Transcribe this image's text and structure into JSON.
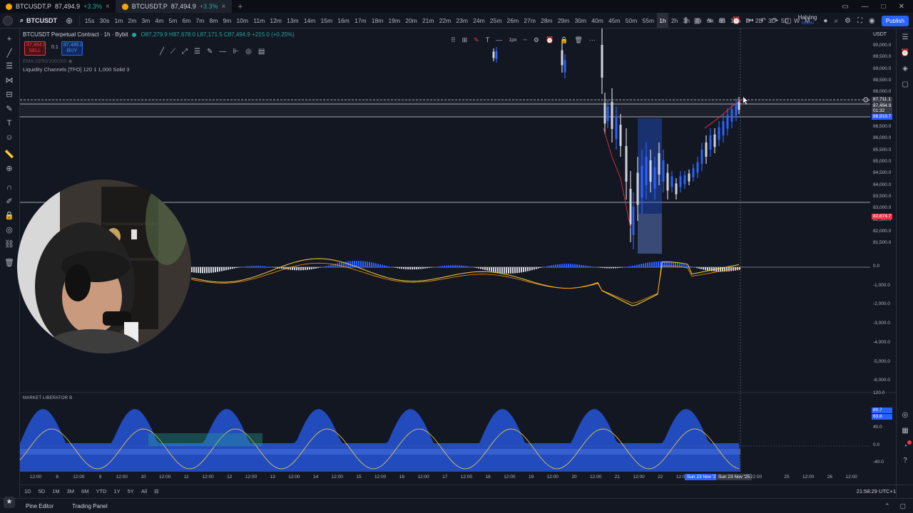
{
  "browser": {
    "tabs": [
      {
        "title": "BTCUSDT.P",
        "price": "87,494.9",
        "change": "+3.3%",
        "close": "×"
      },
      {
        "title": "BTCUSDT.P",
        "price": "87,494.9",
        "change": "+3.3%",
        "close": "×"
      }
    ],
    "add_tab": "+"
  },
  "toolbar": {
    "symbol": "BTCUSDT",
    "timeframes": [
      "15s",
      "30s",
      "1m",
      "2m",
      "3m",
      "4m",
      "5m",
      "6m",
      "7m",
      "8m",
      "9m",
      "10m",
      "11m",
      "12m",
      "13m",
      "14m",
      "15m",
      "16m",
      "17m",
      "18m",
      "19m",
      "20m",
      "21m",
      "22m",
      "23m",
      "24m",
      "25m",
      "26m",
      "27m",
      "28m",
      "29m",
      "30m",
      "40m",
      "45m",
      "50m",
      "55m",
      "1h",
      "2h",
      "3h",
      "4h",
      "6h",
      "8h",
      "12h",
      "D",
      "2D",
      "3D",
      "5D",
      "W",
      "M"
    ],
    "active_timeframe": "1h",
    "halving": "Halving",
    "halving_sub": "SOON",
    "publish": "Publish"
  },
  "legend": {
    "title": "BTCUSDT Perpetual Contract · 1h · Bybit",
    "ohlc": "O87,279.9 H87,678.0 L87,171.5 C87,494.9 +215.0 (+0.25%)",
    "sell_price": "87,494.9",
    "sell_label": "SELL",
    "spread": "0.1",
    "buy_price": "87,495.0",
    "buy_label": "BUY",
    "ema": "EMA 20/50/100/200",
    "liquidity": "Liquidity Channels [TFO] 120 1 1,000 Solid 3",
    "market_liberator": "MARKET LIBERATOR B"
  },
  "price_scale": {
    "unit": "USDT",
    "labels": [
      "90,000.0",
      "89,500.0",
      "89,000.0",
      "88,500.0",
      "88,000.0",
      "87,500.0",
      "87,000.0",
      "86,500.0",
      "86,000.0",
      "85,500.0",
      "85,000.0",
      "84,500.0",
      "84,000.0",
      "83,500.0",
      "83,000.0",
      "82,500.0",
      "82,000.0",
      "81,500.0"
    ],
    "tag_top": "87,711.1",
    "tag_current": "87,494.9",
    "tag_current_time": "01:32",
    "tag_level": "86,919.7",
    "tag_low": "82,674.7"
  },
  "macd_scale": [
    "0.0",
    "-1,000.0",
    "-2,000.0",
    "-3,000.0",
    "-4,000.0",
    "-5,000.0",
    "-6,000.0"
  ],
  "osc_scale": {
    "labels": [
      "120.0",
      "40.0",
      "0.0",
      "-40.0"
    ],
    "tag_a": "80.7",
    "tag_b": "63.8"
  },
  "time_axis": {
    "labels": [
      "12:00",
      "8",
      "12:00",
      "9",
      "12:00",
      "10",
      "12:00",
      "11",
      "12:00",
      "12",
      "12:00",
      "13",
      "12:00",
      "14",
      "12:00",
      "15",
      "12:00",
      "16",
      "12:00",
      "17",
      "12:00",
      "18",
      "12:00",
      "19",
      "12:00",
      "20",
      "12:00",
      "21",
      "12:00",
      "22",
      "12:00"
    ],
    "highlight": "Sun 23 Nov '2",
    "crosshair": "Sun 23 Nov '25",
    "crosshair_time": "22:00",
    "future": [
      "25",
      "12:00",
      "26",
      "12:00"
    ]
  },
  "ranges": [
    "1D",
    "5D",
    "1M",
    "3M",
    "6M",
    "YTD",
    "1Y",
    "5Y",
    "All"
  ],
  "clock": "21:58:29 UTC+1",
  "footer": {
    "pine_editor": "Pine Editor",
    "trading_panel": "Trading Panel"
  },
  "colors": {
    "bg": "#131722",
    "up": "#26a69a",
    "down": "#f23645",
    "accent": "#2962ff"
  }
}
